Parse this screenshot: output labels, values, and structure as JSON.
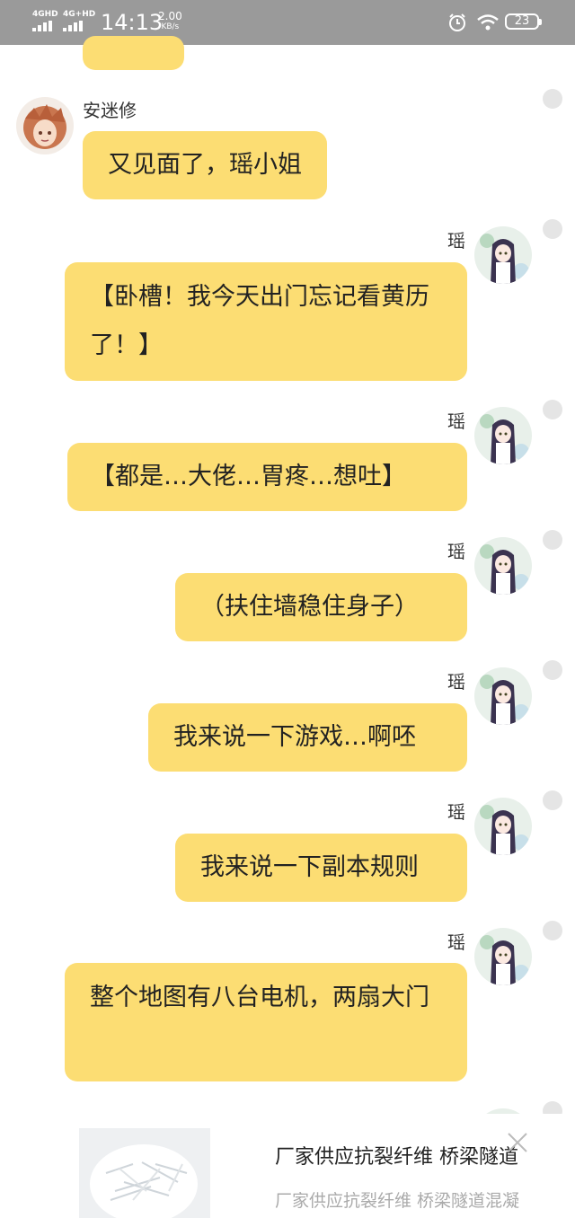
{
  "status_bar": {
    "network_1": "4GHD",
    "network_2": "4G+HD",
    "time": "14:13",
    "speed_value": "2.00",
    "speed_unit": "KB/s",
    "battery": "23"
  },
  "chat": {
    "messages": [
      {
        "sender": "安迷修",
        "text": "又见面了，瑶小姐"
      },
      {
        "sender": "瑶",
        "text": "【卧槽！我今天出门忘记看黄历了！】"
      },
      {
        "sender": "瑶",
        "text": "【都是…大佬…胃疼…想吐】"
      },
      {
        "sender": "瑶",
        "text": "（扶住墙稳住身子）"
      },
      {
        "sender": "瑶",
        "text": "我来说一下游戏…啊呸"
      },
      {
        "sender": "瑶",
        "text": "我来说一下副本规则"
      },
      {
        "sender": "瑶",
        "text": "整个地图有八台电机，两扇大门"
      },
      {
        "sender": "瑶",
        "text": ""
      }
    ]
  },
  "ad": {
    "title": "厂家供应抗裂纤维 桥梁隧道",
    "subtitle": "厂家供应抗裂纤维 桥梁隧道混凝"
  },
  "colors": {
    "bubble": "#fcdd73",
    "status_bar": "#9a9a9a"
  }
}
